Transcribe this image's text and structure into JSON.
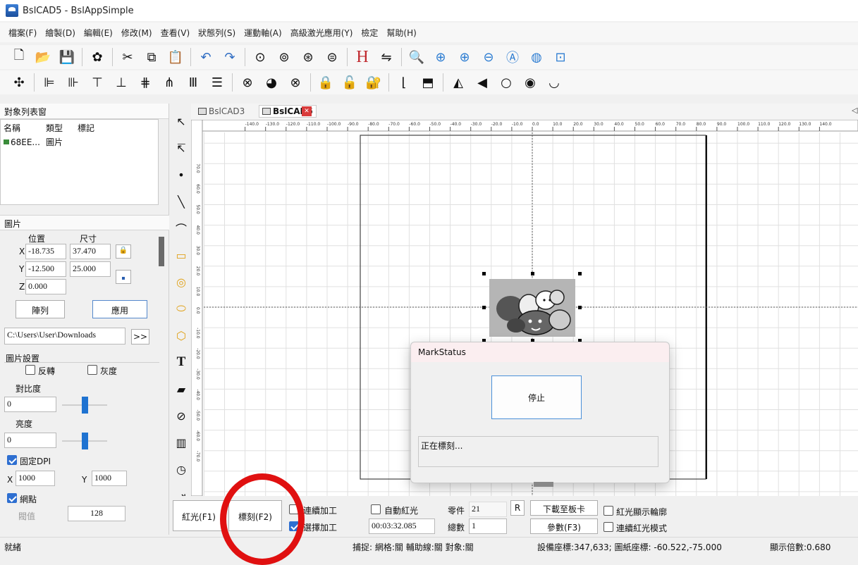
{
  "window": {
    "title": "BslCAD5 - BslAppSimple"
  },
  "menu": [
    "檔案(F)",
    "繪製(D)",
    "編輯(E)",
    "修改(M)",
    "查看(V)",
    "狀態列(S)",
    "運動軸(A)",
    "高級激光應用(Y)",
    "檢定",
    "幫助(H)"
  ],
  "toolbar1": [
    {
      "name": "new-icon",
      "glyph": "🗋"
    },
    {
      "name": "open-icon",
      "glyph": "📂"
    },
    {
      "name": "save-icon",
      "glyph": "💾"
    },
    "sep",
    {
      "name": "settings-gear-icon",
      "glyph": "✿"
    },
    "sep",
    {
      "name": "cut-icon",
      "glyph": "✂"
    },
    {
      "name": "copy-icon",
      "glyph": "⧉"
    },
    {
      "name": "paste-icon",
      "glyph": "📋"
    },
    "sep",
    {
      "name": "undo-icon",
      "glyph": "↶"
    },
    {
      "name": "redo-icon",
      "glyph": "↷"
    },
    "sep",
    {
      "name": "select-all-icon",
      "glyph": "⊙"
    },
    {
      "name": "select-invert-icon",
      "glyph": "⊚"
    },
    {
      "name": "group-icon",
      "glyph": "⊛"
    },
    {
      "name": "ungroup-icon",
      "glyph": "⊜"
    },
    "sep",
    {
      "name": "hatch-icon",
      "glyph": "H"
    },
    {
      "name": "convert-icon",
      "glyph": "⇋"
    },
    "sep",
    {
      "name": "zoom-icon",
      "glyph": "🔍"
    },
    {
      "name": "zoom-pan-icon",
      "glyph": "⊕"
    },
    {
      "name": "zoom-in-icon",
      "glyph": "⊕"
    },
    {
      "name": "zoom-out-icon",
      "glyph": "⊖"
    },
    {
      "name": "zoom-all-icon",
      "glyph": "Ⓐ"
    },
    {
      "name": "zoom-select-icon",
      "glyph": "◍"
    },
    {
      "name": "zoom-page-icon",
      "glyph": "⊡"
    }
  ],
  "toolbar2": [
    {
      "name": "align-center-icon",
      "glyph": "✣"
    },
    "sep",
    {
      "name": "align-left-icon",
      "glyph": "⊫"
    },
    {
      "name": "align-right-icon",
      "glyph": "⊪"
    },
    {
      "name": "align-top-icon",
      "glyph": "⊤"
    },
    {
      "name": "align-bottom-icon",
      "glyph": "⊥"
    },
    {
      "name": "align-hcenter-icon",
      "glyph": "⋕"
    },
    {
      "name": "align-vcenter-icon",
      "glyph": "⋔"
    },
    {
      "name": "same-width-icon",
      "glyph": "Ⅲ"
    },
    {
      "name": "same-height-icon",
      "glyph": "☰"
    },
    "sep",
    {
      "name": "rotate-icon",
      "glyph": "⊗"
    },
    {
      "name": "arc-icon",
      "glyph": "◕"
    },
    {
      "name": "close-path-icon",
      "glyph": "⊗"
    },
    "sep",
    {
      "name": "lock-icon",
      "glyph": "🔒"
    },
    {
      "name": "unlock-icon",
      "glyph": "🔓"
    },
    {
      "name": "lock-all-icon",
      "glyph": "🔐"
    },
    "sep",
    {
      "name": "axis-icon",
      "glyph": "⌊"
    },
    {
      "name": "bring-front-icon",
      "glyph": "⬒"
    },
    "sep",
    {
      "name": "mirror-h-icon",
      "glyph": "◭"
    },
    {
      "name": "mirror-v-icon",
      "glyph": "◀"
    },
    {
      "name": "ellipse-icon",
      "glyph": "○"
    },
    {
      "name": "show-icon",
      "glyph": "◉"
    },
    {
      "name": "hide-icon",
      "glyph": "◡"
    }
  ],
  "objects_panel": {
    "title": "對象列表窗",
    "col_name": "名稱",
    "col_type": "類型",
    "col_mark": "標記",
    "rows": [
      {
        "name": "68EE...",
        "type": "圖片"
      }
    ]
  },
  "props": {
    "title": "圖片",
    "pos_label": "位置",
    "size_label": "尺寸",
    "x_label": "X",
    "y_label": "Y",
    "z_label": "Z",
    "x": "-18.735",
    "y": "-12.500",
    "z": "0.000",
    "w": "37.470",
    "h": "25.000",
    "array_btn": "陣列",
    "apply_btn": "應用",
    "path": "C:\\Users\\User\\Downloads",
    "browse_btn": ">>",
    "image_settings": "圖片設置",
    "invert": "反轉",
    "grayscale": "灰度",
    "contrast_label": "對比度",
    "contrast": "0",
    "contrast_level": 0.5,
    "brightness_label": "亮度",
    "brightness": "0",
    "brightness_level": 0.5,
    "fixed_dpi": "固定DPI",
    "dpi_x_label": "X",
    "dpi_x": "1000",
    "dpi_y_label": "Y",
    "dpi_y": "1000",
    "dither": "網點",
    "threshold_label": "閥值",
    "threshold": "128"
  },
  "drawtools": [
    {
      "name": "pointer-tool-icon",
      "glyph": "↖"
    },
    {
      "name": "node-edit-tool-icon",
      "glyph": "↸"
    },
    {
      "name": "point-tool-icon",
      "glyph": "•"
    },
    {
      "name": "line-tool-icon",
      "glyph": "╲"
    },
    {
      "name": "curve-tool-icon",
      "glyph": "⌒"
    },
    {
      "name": "rectangle-tool-icon",
      "glyph": "▭"
    },
    {
      "name": "circle-tool-icon",
      "glyph": "◎"
    },
    {
      "name": "ellipse-tool-icon",
      "glyph": "⬭"
    },
    {
      "name": "polygon-tool-icon",
      "glyph": "⬡"
    },
    {
      "name": "text-tool-icon",
      "glyph": "T"
    },
    {
      "name": "image-tool-icon",
      "glyph": "▰"
    },
    {
      "name": "vector-file-tool-icon",
      "glyph": "⊘"
    },
    {
      "name": "barcode-tool-icon",
      "glyph": "▥"
    },
    {
      "name": "timer-tool-icon",
      "glyph": "◷"
    },
    {
      "name": "input-port-tool-icon",
      "glyph": "⇥"
    }
  ],
  "tabs": [
    {
      "label": "BslCAD3"
    },
    {
      "label": "BslCAD5"
    }
  ],
  "ruler_labels": [
    "-140.0",
    "-130.0",
    "-120.0",
    "-110.0",
    "-100.0",
    "-90.0",
    "-80.0",
    "-70.0",
    "-60.0",
    "-50.0",
    "-40.0",
    "-30.0",
    "-20.0",
    "-10.0",
    "0.0",
    "10.0",
    "20.0",
    "30.0",
    "40.0",
    "50.0",
    "60.0",
    "70.0",
    "80.0",
    "90.0",
    "100.0",
    "110.0",
    "120.0",
    "130.0",
    "140.0"
  ],
  "vruler_labels": [
    "70.0",
    "60.0",
    "50.0",
    "40.0",
    "30.0",
    "20.0",
    "10.0",
    "0.0",
    "-10.0",
    "-20.0",
    "-30.0",
    "-40.0",
    "-50.0",
    "-60.0",
    "-70.0"
  ],
  "bottom": {
    "red_btn": "紅光(F1)",
    "mark_btn": "標刻(F2)",
    "continuous": "連續加工",
    "select_process": "選擇加工",
    "auto_red": "自動紅光",
    "elapsed": "00:03:32.085",
    "parts_label": "零件",
    "parts": "21",
    "reset_btn": "R",
    "total_label": "總數",
    "total": "1",
    "download_btn": "下載至板卡",
    "params_btn": "參數(F3)",
    "red_outline": "紅光顯示輪廓",
    "continuous_red": "連續紅光模式"
  },
  "status": {
    "ready": "就緒",
    "snap": "捕捉: 網格:關 輔助線:關 對象:關",
    "coords": "設備座標:347,633; 圖紙座標: -60.522,-75.000",
    "zoom": "顯示倍數:0.680"
  },
  "dialog": {
    "title": "MarkStatus",
    "stop_btn": "停止",
    "status_text": "正在標刻..."
  },
  "colors": {
    "accent": "#2e6fd1",
    "highlight_circle": "#e01010",
    "close_tab": "#d93b3b"
  }
}
